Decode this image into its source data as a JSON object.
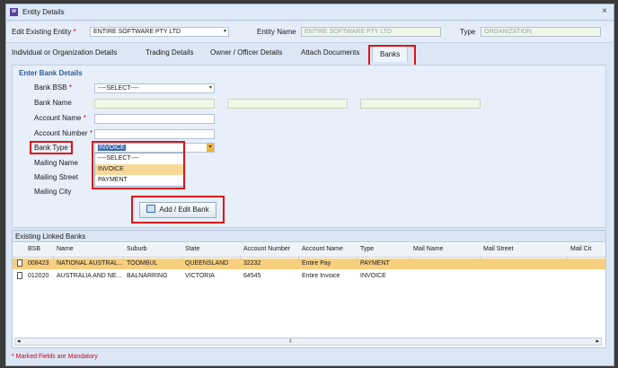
{
  "window": {
    "app_icon": "W",
    "title": "Entity Details",
    "close": "×"
  },
  "topbar": {
    "edit_label": "Edit Existing Entity",
    "required_mark": "*",
    "entity_value": "ENTIRE SOFTWARE PTY LTD",
    "entity_name_label": "Entity Name",
    "entity_name_value": "ENTIRE SOFTWARE PTY LTD",
    "type_label": "Type",
    "type_value": "ORGANIZATION"
  },
  "tabs": [
    {
      "label": "Individual or Organization Details"
    },
    {
      "label": "Trading Details"
    },
    {
      "label": "Owner / Officer Details"
    },
    {
      "label": "Attach Documents"
    },
    {
      "label": "Banks"
    }
  ],
  "bank_form": {
    "section_title": "Enter Bank Details",
    "bsb_label": "Bank BSB",
    "bsb_value": "----SELECT----",
    "bank_name_label": "Bank Name",
    "account_name_label": "Account Name",
    "account_number_label": "Account Number",
    "bank_type_label": "Bank Type",
    "bank_type_value": "INVOICE",
    "bank_type_options": [
      "----SELECT----",
      "INVOICE",
      "PAYMENT"
    ],
    "mailing_name_label": "Mailing Name",
    "mailing_street_label": "Mailing Street",
    "mailing_city_label": "Mailing City",
    "add_edit_button": "Add / Edit Bank"
  },
  "linked_banks": {
    "title": "Existing Linked Banks",
    "columns": [
      "BSB",
      "Name",
      "Suburb",
      "State",
      "Account Number",
      "Account Name",
      "Type",
      "Mail Name",
      "Mail Street",
      "Mail Cit"
    ],
    "rows": [
      [
        "008423",
        "NATIONAL AUSTRAL...",
        "TOOMBUL",
        "QUEENSLAND",
        "32232",
        "Entire Pay",
        "PAYMENT",
        "",
        "",
        ""
      ],
      [
        "012020",
        "AUSTRALIA AND NE...",
        "BALNARRING",
        "VICTORIA",
        "64545",
        "Entire Invoice",
        "INVOICE",
        "",
        "",
        ""
      ]
    ],
    "scroll_left": "◂",
    "scroll_right": "▸",
    "scroll_thumb": "⦀"
  },
  "footer": "* Marked Fields are Mandatory",
  "colors": {
    "accent_red": "#e01212",
    "selected_row": "#f8cf7e",
    "section_title": "#2f5b9a"
  }
}
